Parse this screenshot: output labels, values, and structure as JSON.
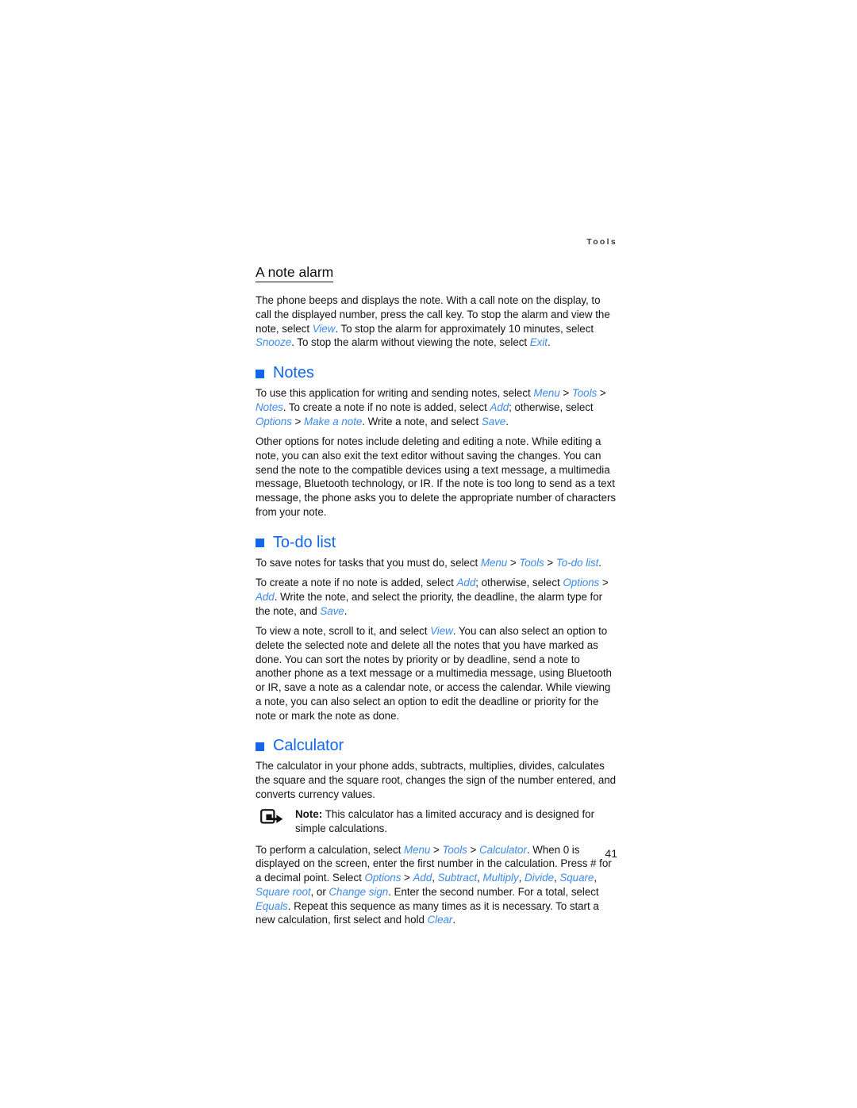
{
  "page": {
    "running_head": "Tools",
    "folio": "41",
    "heading_color": "#1266ee",
    "reference_color": "#3d8ae8",
    "body_color": "#141414"
  },
  "sections": [
    {
      "id": "a-note-alarm",
      "level": "h3",
      "title": "A note alarm",
      "paragraphs": [
        {
          "id": "note-alarm-p1",
          "runs": [
            {
              "t": "The phone beeps and displays the note. With a call note on the display, to call the displayed number, press the call key. To stop the alarm and view the note, select ",
              "s": "plain"
            },
            {
              "t": "View",
              "s": "ref"
            },
            {
              "t": ". To stop the alarm for approximately 10 minutes, select ",
              "s": "plain"
            },
            {
              "t": "Snooze",
              "s": "ref"
            },
            {
              "t": ". To stop the alarm without viewing the note, select ",
              "s": "plain"
            },
            {
              "t": "Exit",
              "s": "ref"
            },
            {
              "t": ".",
              "s": "plain"
            }
          ]
        }
      ]
    },
    {
      "id": "notes",
      "level": "h2",
      "title": "Notes",
      "bullet": "square-bullet-icon",
      "paragraphs": [
        {
          "id": "notes-p1",
          "runs": [
            {
              "t": "To use this application for writing and sending notes, select ",
              "s": "plain"
            },
            {
              "t": "Menu",
              "s": "ref"
            },
            {
              "t": " > ",
              "s": "plain"
            },
            {
              "t": "Tools",
              "s": "ref"
            },
            {
              "t": " > ",
              "s": "plain"
            },
            {
              "t": "Notes",
              "s": "ref"
            },
            {
              "t": ". To create a note if no note is added, select ",
              "s": "plain"
            },
            {
              "t": "Add",
              "s": "ref"
            },
            {
              "t": "; otherwise, select ",
              "s": "plain"
            },
            {
              "t": "Options",
              "s": "ref"
            },
            {
              "t": " > ",
              "s": "plain"
            },
            {
              "t": "Make a note",
              "s": "ref"
            },
            {
              "t": ". Write a note, and select ",
              "s": "plain"
            },
            {
              "t": "Save",
              "s": "ref"
            },
            {
              "t": ".",
              "s": "plain"
            }
          ]
        },
        {
          "id": "notes-p2",
          "runs": [
            {
              "t": "Other options for notes include deleting and editing a note. While editing a note, you can also exit the text editor without saving the changes. You can send the note to the compatible devices using a text message, a multimedia message, Bluetooth technology, or IR. If the note is too long to send as a text message, the phone asks you to delete the appropriate number of characters from your note.",
              "s": "plain"
            }
          ]
        }
      ]
    },
    {
      "id": "to-do-list",
      "level": "h2",
      "title": "To-do list",
      "bullet": "square-bullet-icon",
      "paragraphs": [
        {
          "id": "todo-p1",
          "runs": [
            {
              "t": "To save notes for tasks that you must do, select ",
              "s": "plain"
            },
            {
              "t": "Menu",
              "s": "ref"
            },
            {
              "t": " > ",
              "s": "plain"
            },
            {
              "t": "Tools",
              "s": "ref"
            },
            {
              "t": " > ",
              "s": "plain"
            },
            {
              "t": "To-do list",
              "s": "ref"
            },
            {
              "t": ".",
              "s": "plain"
            }
          ]
        },
        {
          "id": "todo-p2",
          "runs": [
            {
              "t": "To create a note if no note is added, select ",
              "s": "plain"
            },
            {
              "t": "Add",
              "s": "ref"
            },
            {
              "t": "; otherwise, select ",
              "s": "plain"
            },
            {
              "t": "Options",
              "s": "ref"
            },
            {
              "t": " > ",
              "s": "plain"
            },
            {
              "t": "Add",
              "s": "ref"
            },
            {
              "t": ". Write the note, and select the priority, the deadline, the alarm type for the note, and ",
              "s": "plain"
            },
            {
              "t": "Save",
              "s": "ref"
            },
            {
              "t": ".",
              "s": "plain"
            }
          ]
        },
        {
          "id": "todo-p3",
          "runs": [
            {
              "t": "To view a note, scroll to it, and select ",
              "s": "plain"
            },
            {
              "t": "View",
              "s": "ref"
            },
            {
              "t": ". You can also select an option to delete the selected note and delete all the notes that you have marked as done. You can sort the notes by priority or by deadline, send a note to another phone as a text message or a multimedia message, using Bluetooth or IR, save a note as a calendar note, or access the calendar. While viewing a note, you can also select an option to edit the deadline or priority for the note or mark the note as done.",
              "s": "plain"
            }
          ]
        }
      ]
    },
    {
      "id": "calculator",
      "level": "h2",
      "title": "Calculator",
      "bullet": "square-bullet-icon",
      "paragraphs": [
        {
          "id": "calc-p1",
          "runs": [
            {
              "t": "The calculator in your phone adds, subtracts, multiplies, divides, calculates the square and the square root, changes the sign of the number entered, and converts currency values.",
              "s": "plain"
            }
          ]
        }
      ],
      "note": {
        "icon": "note-pointer-icon",
        "label": "Note:",
        "text": " This calculator has a limited accuracy and is designed for simple calculations."
      },
      "paragraphs_after": [
        {
          "id": "calc-p2",
          "runs": [
            {
              "t": "To perform a calculation, select ",
              "s": "plain"
            },
            {
              "t": "Menu",
              "s": "ref"
            },
            {
              "t": " > ",
              "s": "plain"
            },
            {
              "t": "Tools",
              "s": "ref"
            },
            {
              "t": " > ",
              "s": "plain"
            },
            {
              "t": "Calculator",
              "s": "ref"
            },
            {
              "t": ". When 0 is displayed on the screen, enter the first number in the calculation. Press # for a decimal point. Select ",
              "s": "plain"
            },
            {
              "t": "Options",
              "s": "ref"
            },
            {
              "t": " > ",
              "s": "plain"
            },
            {
              "t": "Add",
              "s": "ref"
            },
            {
              "t": ", ",
              "s": "plain"
            },
            {
              "t": "Subtract",
              "s": "ref"
            },
            {
              "t": ", ",
              "s": "plain"
            },
            {
              "t": "Multiply",
              "s": "ref"
            },
            {
              "t": ", ",
              "s": "plain"
            },
            {
              "t": "Divide",
              "s": "ref"
            },
            {
              "t": ", ",
              "s": "plain"
            },
            {
              "t": "Square",
              "s": "ref"
            },
            {
              "t": ", ",
              "s": "plain"
            },
            {
              "t": "Square root",
              "s": "ref"
            },
            {
              "t": ", or ",
              "s": "plain"
            },
            {
              "t": "Change sign",
              "s": "ref"
            },
            {
              "t": ". Enter the second number. For a total, select ",
              "s": "plain"
            },
            {
              "t": "Equals",
              "s": "ref"
            },
            {
              "t": ". Repeat this sequence as many times as it is necessary. To start a new calculation, first select and hold ",
              "s": "plain"
            },
            {
              "t": "Clear",
              "s": "ref"
            },
            {
              "t": ".",
              "s": "plain"
            }
          ]
        }
      ]
    }
  ]
}
